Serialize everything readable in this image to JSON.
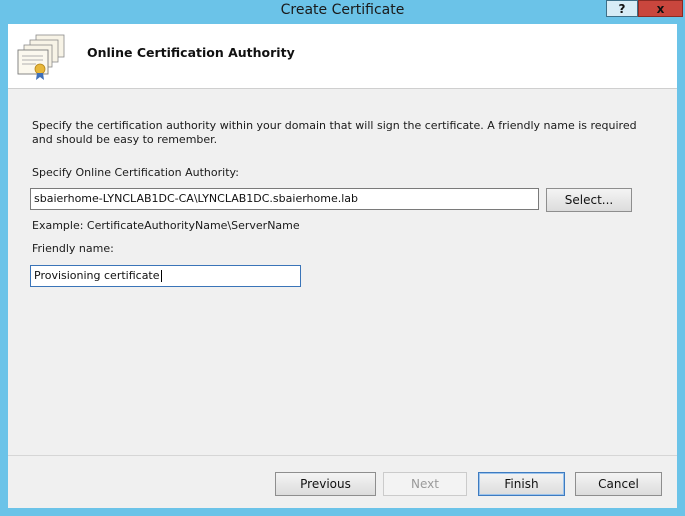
{
  "window": {
    "title": "Create Certificate",
    "help_label": "?",
    "close_label": "x"
  },
  "header": {
    "title": "Online Certification Authority",
    "icon": "certificates-icon"
  },
  "body": {
    "description": "Specify the certification authority within your domain that will sign the certificate. A friendly name is required and should be easy to remember.",
    "ca_label": "Specify Online Certification Authority:",
    "ca_value": "sbaierhome-LYNCLAB1DC-CA\\LYNCLAB1DC.sbaierhome.lab",
    "select_label": "Select...",
    "example_text": "Example: CertificateAuthorityName\\ServerName",
    "friendly_label": "Friendly name:",
    "friendly_value": "Provisioning certificate"
  },
  "footer": {
    "previous_label": "Previous",
    "next_label": "Next",
    "finish_label": "Finish",
    "cancel_label": "Cancel"
  },
  "colors": {
    "frame": "#6bc3e8",
    "close": "#c9463d",
    "panel": "#f0f0f0"
  }
}
